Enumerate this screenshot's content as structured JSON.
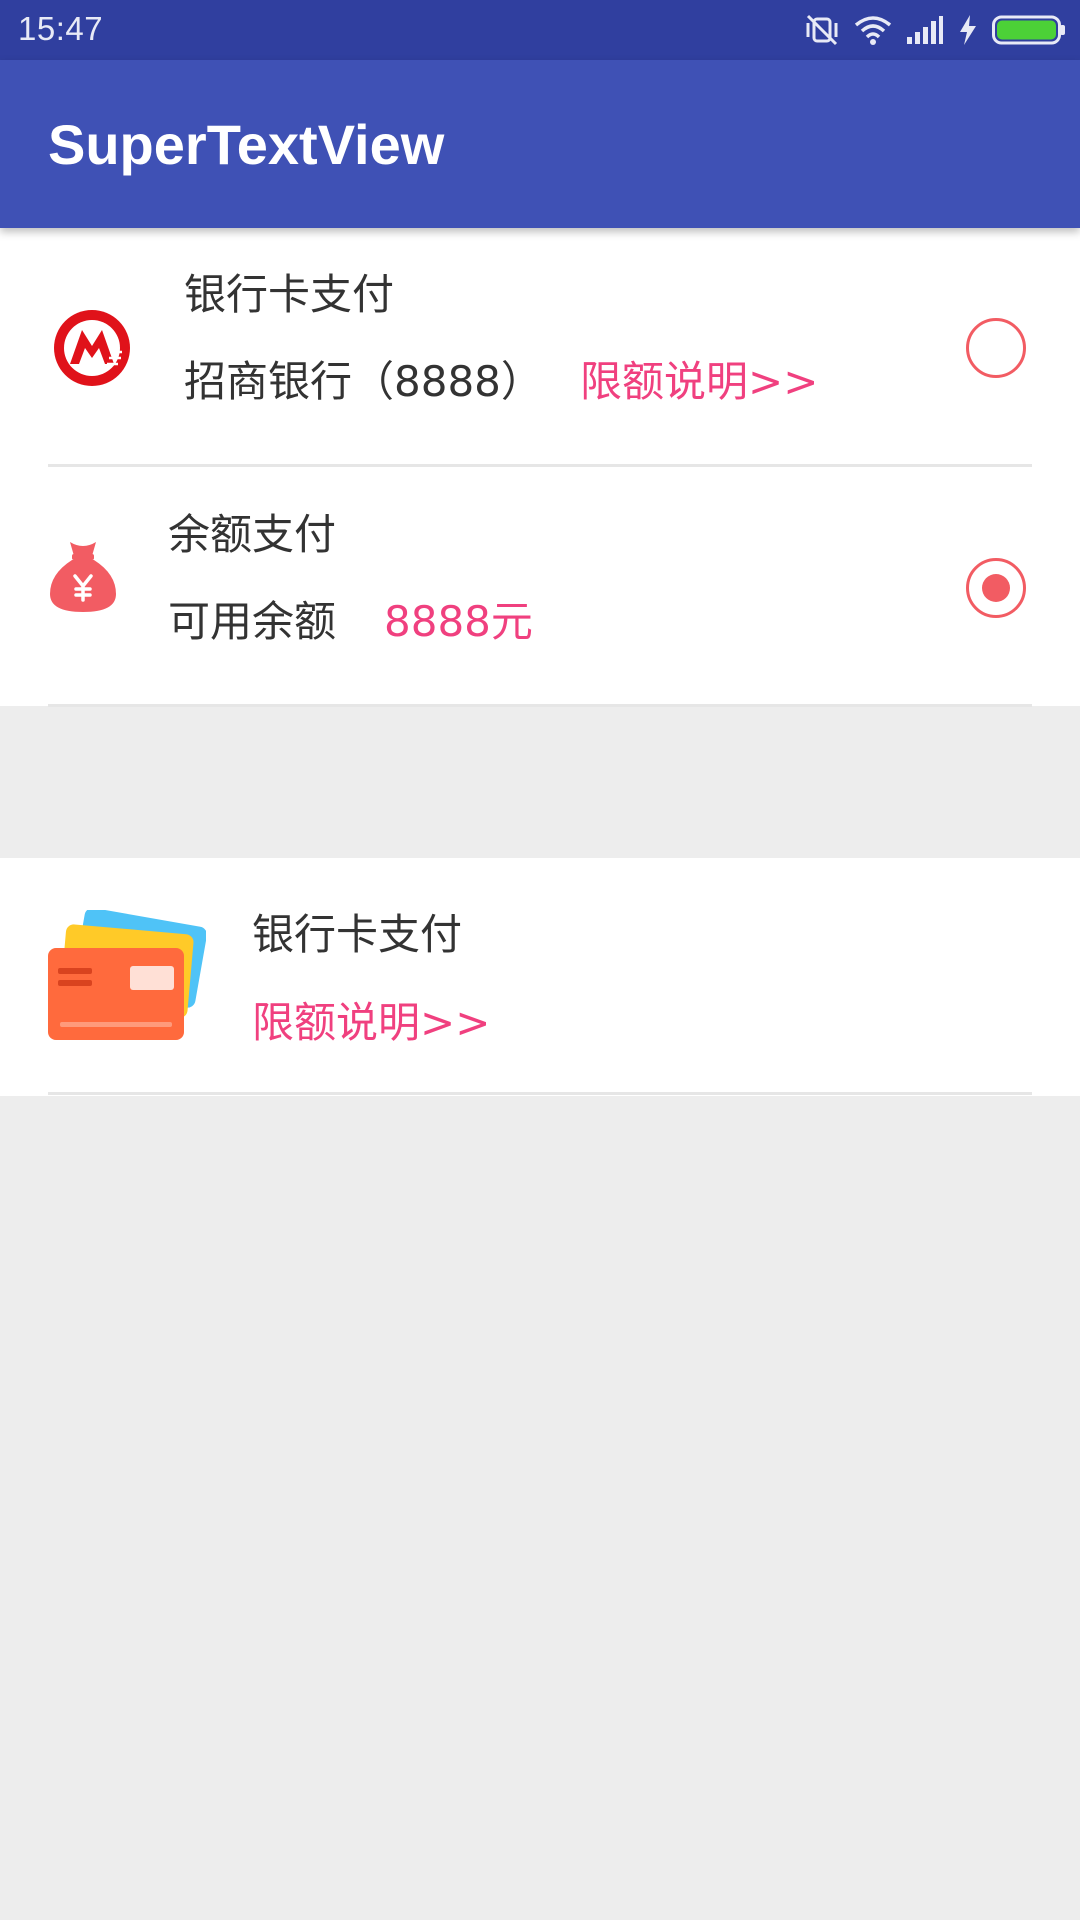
{
  "status_bar": {
    "time": "15:47",
    "icons": [
      "vibrate-off-icon",
      "wifi-icon",
      "signal-icon",
      "charging-icon",
      "battery-icon"
    ],
    "battery_color": "#4cd137"
  },
  "app_bar": {
    "title": "SuperTextView",
    "color": "#3f51b5"
  },
  "payment_options": [
    {
      "icon": "cmb-bank-logo-icon",
      "title": "银行卡支付",
      "subtitle": "招商银行（8888）",
      "link": "限额说明>>",
      "selected": false
    },
    {
      "icon": "money-bag-icon",
      "title": "余额支付",
      "subtitle": "可用余额",
      "amount": "8888元",
      "selected": true
    }
  ],
  "card_section": {
    "icon": "bank-cards-icon",
    "title": "银行卡支付",
    "link": "限额说明>>"
  },
  "colors": {
    "accent_pink": "#f0407f",
    "radio_red": "#f25c63",
    "background": "#ededed"
  }
}
